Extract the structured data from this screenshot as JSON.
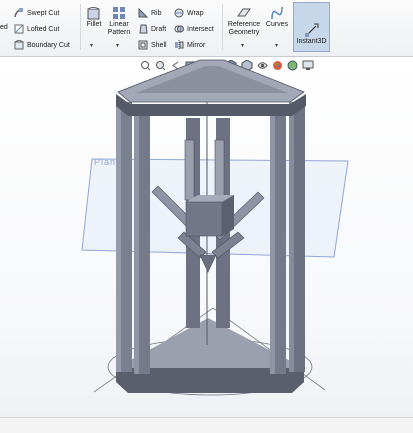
{
  "ribbon": {
    "partial_label": "ed",
    "cut_tools": [
      "Swept Cut",
      "Lofted Cut",
      "Boundary Cut"
    ],
    "fillet": "Fillet",
    "linear_pattern": [
      "Linear",
      "Pattern"
    ],
    "features_col1": [
      "Rib",
      "Draft",
      "Shell"
    ],
    "features_col2": [
      "Wrap",
      "Intersect",
      "Mirror"
    ],
    "reference_geometry": [
      "Reference",
      "Geometry"
    ],
    "curves": "Curves",
    "instant3d": "Instant3D",
    "active_tool": "Instant3D"
  },
  "viewport": {
    "plane_label": "Plane1"
  },
  "colors": {
    "part_face": "#7f8596",
    "part_dark": "#4c5160",
    "plane_edge": "#8fa6d8",
    "selection_fill": "#c7d7ea"
  }
}
